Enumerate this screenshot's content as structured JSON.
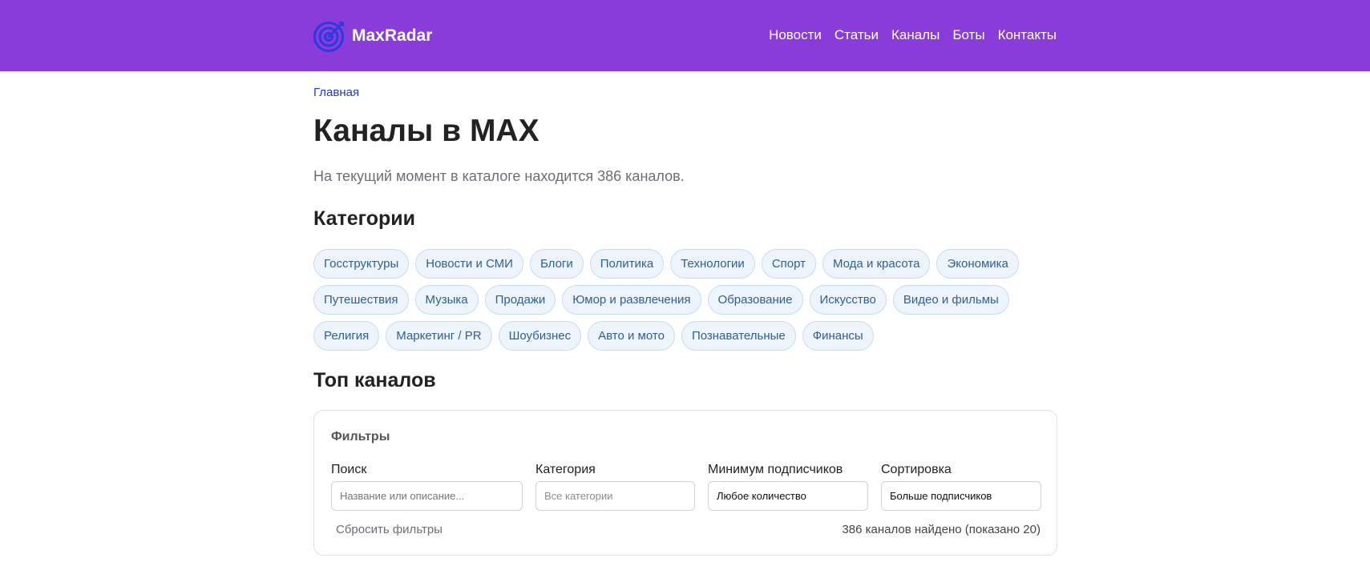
{
  "header": {
    "brand": "MaxRadar",
    "nav": [
      "Новости",
      "Статьи",
      "Каналы",
      "Боты",
      "Контакты"
    ]
  },
  "breadcrumb": "Главная",
  "title": "Каналы в MAX",
  "lead": "На текущий момент в каталоге находится 386 каналов.",
  "categories": {
    "heading": "Категории",
    "items": [
      "Госструктуры",
      "Новости и СМИ",
      "Блоги",
      "Политика",
      "Технологии",
      "Спорт",
      "Мода и красота",
      "Экономика",
      "Путешествия",
      "Музыка",
      "Продажи",
      "Юмор и развлечения",
      "Образование",
      "Искусство",
      "Видео и фильмы",
      "Религия",
      "Маркетинг / PR",
      "Шоубизнес",
      "Авто и мото",
      "Познавательные",
      "Финансы"
    ]
  },
  "top": {
    "heading": "Топ каналов",
    "filters": {
      "title": "Фильтры",
      "search": {
        "label": "Поиск",
        "placeholder": "Название или описание..."
      },
      "category": {
        "label": "Категория",
        "placeholder": "Все категории"
      },
      "min_subscribers": {
        "label": "Минимум подписчиков",
        "value": "Любое количество"
      },
      "sort": {
        "label": "Сортировка",
        "value": "Больше подписчиков"
      },
      "reset": "Сбросить фильтры",
      "found": "386 каналов найдено (показано 20)"
    }
  },
  "icons": {
    "logo": "target-icon"
  },
  "colors": {
    "header_bg": "#8a3cdb",
    "logo": "#2a3ae0",
    "link": "#1f3bd1",
    "chip_bg": "#eef4fb",
    "chip_text": "#2f5f98"
  }
}
